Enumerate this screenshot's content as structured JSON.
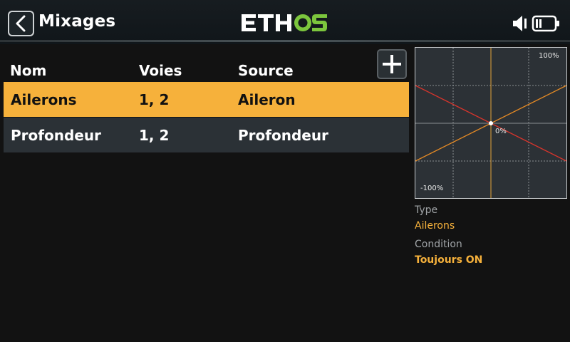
{
  "header": {
    "title": "Mixages",
    "brand": "ETHOS"
  },
  "table": {
    "columns": [
      "Nom",
      "Voies",
      "Source"
    ],
    "rows": [
      {
        "nom": "Ailerons",
        "voies": "1, 2",
        "source": "Aileron",
        "selected": true
      },
      {
        "nom": "Profondeur",
        "voies": "1, 2",
        "source": "Profondeur",
        "selected": false
      }
    ]
  },
  "curve": {
    "max_label": "100%",
    "center_label": "0%",
    "min_label": "-100%"
  },
  "details": {
    "type_label": "Type",
    "type_value": "Ailerons",
    "condition_label": "Condition",
    "condition_value": "Toujours ON"
  },
  "colors": {
    "accent": "#f6b13b",
    "row_bg": "#2b3136",
    "curve_red": "#d8352c",
    "curve_orange": "#e58a24"
  },
  "icons": [
    "back-arrow-icon",
    "speaker-icon",
    "battery-icon",
    "plus-icon"
  ]
}
